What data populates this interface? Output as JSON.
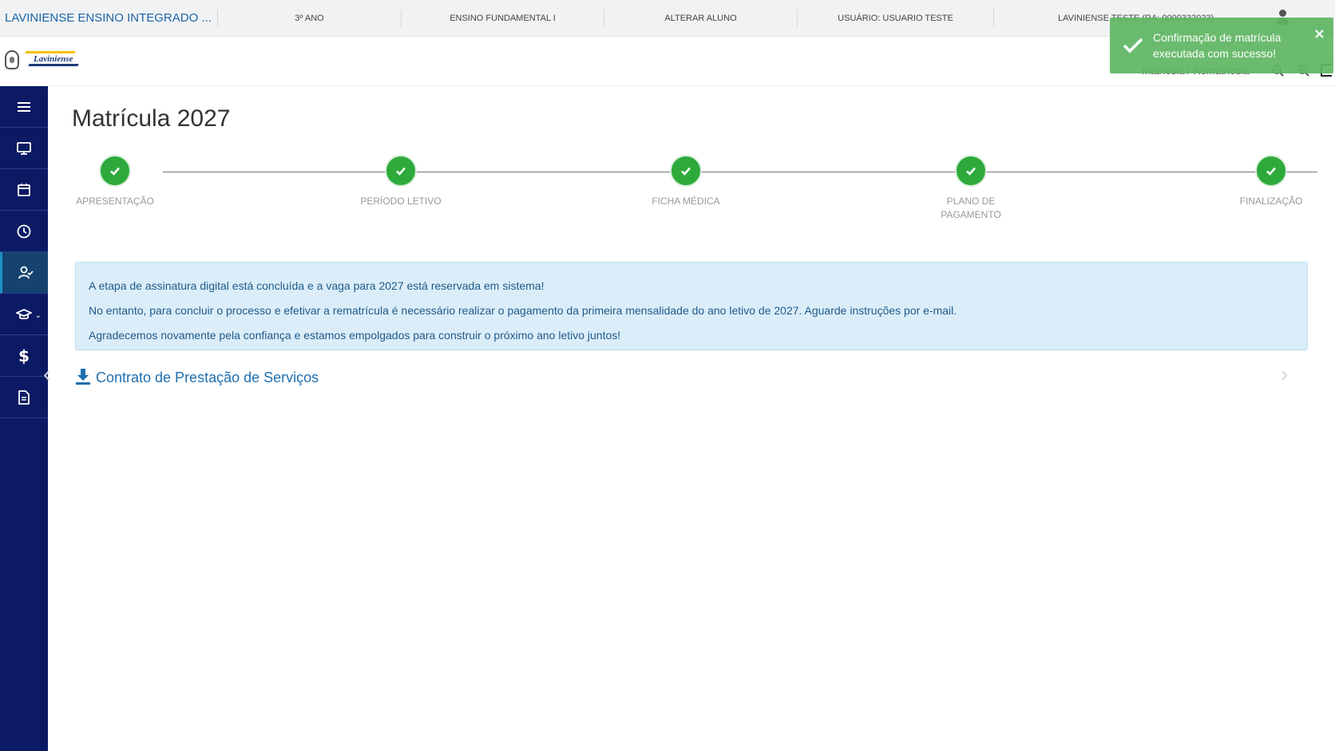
{
  "topbar": {
    "school": "LAVINIENSE ENSINO INTEGRADO ...",
    "grade": "3º ANO",
    "level": "ENSINO FUNDAMENTAL I",
    "change_student": "ALTERAR ALUNO",
    "user": "USUÁRIO: USUARIO TESTE",
    "student": "LAVINIENSE TESTE (RA: 0000332023)"
  },
  "header": {
    "logo_text": "Laviniense",
    "breadcrumb": "Matrícula / Rematrícula"
  },
  "sidebar": {
    "items": [
      {
        "icon": "menu-icon"
      },
      {
        "icon": "monitor-icon"
      },
      {
        "icon": "calendar-icon"
      },
      {
        "icon": "clock-icon"
      },
      {
        "icon": "user-check-icon"
      },
      {
        "icon": "graduation-cap-icon"
      },
      {
        "icon": "dollar-icon",
        "glyph": "$"
      },
      {
        "icon": "document-icon"
      }
    ]
  },
  "main": {
    "title": "Matrícula 2027",
    "steps": [
      {
        "label": "APRESENTAÇÃO",
        "status": "done"
      },
      {
        "label": "PERÍODO LETIVO",
        "status": "done"
      },
      {
        "label": "FICHA MÉDICA",
        "status": "done"
      },
      {
        "label": "PLANO DE PAGAMENTO",
        "status": "done"
      },
      {
        "label": "FINALIZAÇÃO",
        "status": "done"
      }
    ],
    "alert": {
      "line1": "A etapa de assinatura digital está concluída e a vaga para 2027 está reservada em sistema!",
      "line2": "No entanto, para concluir o processo e efetivar a rematrícula é necessário realizar o pagamento da primeira mensalidade do ano letivo de 2027. Aguarde instruções por e-mail.",
      "line3": "Agradecemos novamente pela confiança e estamos empolgados para construir o próximo ano letivo juntos!"
    },
    "contract_link": "Contrato de Prestação de Serviços",
    "nav_prev": "‹",
    "nav_next": "›"
  },
  "toast": {
    "message": "Confirmação de matrícula executada com sucesso!",
    "close": "×"
  },
  "colors": {
    "sidebar": "#0b1a63",
    "step_done": "#2eaa3c",
    "alert_bg": "#dbedf9",
    "toast_bg": "#5fb663",
    "link": "#1f6fb0"
  }
}
